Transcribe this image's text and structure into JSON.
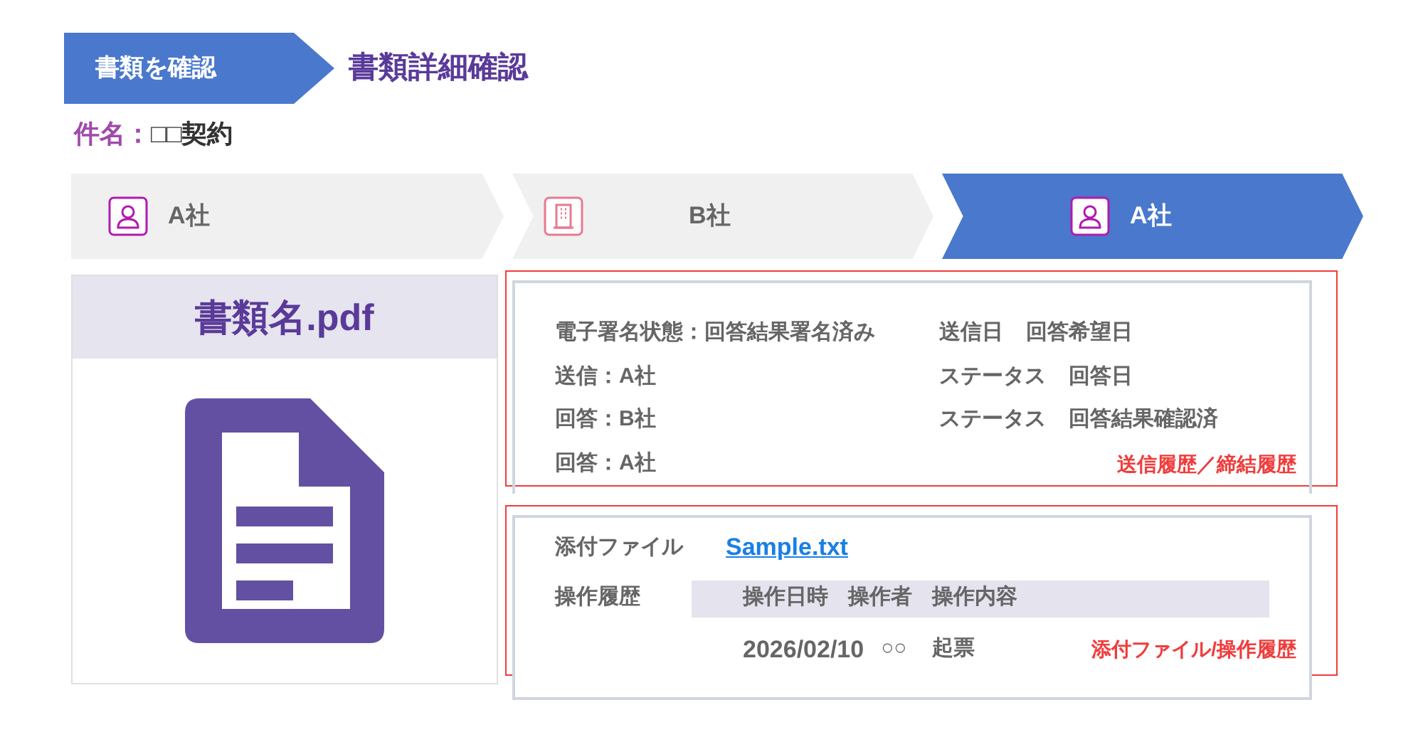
{
  "breadcrumb": {
    "current": "書類を確認",
    "title": "書類詳細確認"
  },
  "subject": {
    "label": "件名：",
    "value": "□□契約"
  },
  "steps": [
    {
      "label": "A社",
      "kind": "person",
      "selected": false
    },
    {
      "label": "B社",
      "kind": "building",
      "selected": false
    },
    {
      "label": "A社",
      "kind": "person",
      "selected": true
    }
  ],
  "document": {
    "filename": "書類名.pdf"
  },
  "history": {
    "left": [
      "電子署名状態：回答結果署名済み",
      "送信：A社",
      "回答：B社",
      "回答：A社"
    ],
    "right": [
      [
        "送信日",
        "回答希望日"
      ],
      [
        "ステータス",
        "回答日"
      ],
      [
        "ステータス",
        "回答結果確認済"
      ]
    ],
    "annotation": "送信履歴／締結履歴"
  },
  "attachments": {
    "label": "添付ファイル",
    "file": "Sample.txt",
    "history_label": "操作履歴",
    "columns": [
      "操作日時",
      "操作者",
      "操作内容"
    ],
    "rows": [
      {
        "date": "2026/02/10",
        "operator": "○○",
        "action": "起票"
      }
    ],
    "annotation": "添付ファイル/操作履歴"
  }
}
